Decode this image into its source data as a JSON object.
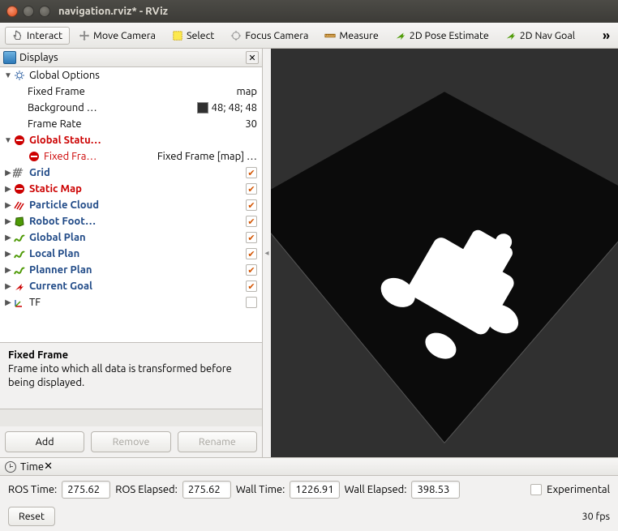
{
  "window": {
    "title": "navigation.rviz* - RViz"
  },
  "toolbar": {
    "interact": "Interact",
    "move_camera": "Move Camera",
    "select": "Select",
    "focus_camera": "Focus Camera",
    "measure": "Measure",
    "pose_estimate": "2D Pose Estimate",
    "nav_goal": "2D Nav Goal"
  },
  "displays": {
    "title": "Displays",
    "global_options": {
      "label": "Global Options"
    },
    "fixed_frame": {
      "label": "Fixed Frame",
      "value": "map"
    },
    "background": {
      "label": "Background …",
      "value": "48; 48; 48"
    },
    "frame_rate": {
      "label": "Frame Rate",
      "value": "30"
    },
    "global_status": {
      "label": "Global Statu…"
    },
    "fixed_frame_status": {
      "label": "Fixed Fra…",
      "value": "Fixed Frame [map] …"
    },
    "grid": {
      "label": "Grid"
    },
    "static_map": {
      "label": "Static Map"
    },
    "particle_cloud": {
      "label": "Particle Cloud"
    },
    "robot_footprint": {
      "label": "Robot Foot…"
    },
    "global_plan": {
      "label": "Global Plan"
    },
    "local_plan": {
      "label": "Local Plan"
    },
    "planner_plan": {
      "label": "Planner Plan"
    },
    "current_goal": {
      "label": "Current Goal"
    },
    "tf": {
      "label": "TF"
    }
  },
  "description": {
    "title": "Fixed Frame",
    "body": "Frame into which all data is transformed before being displayed."
  },
  "buttons": {
    "add": "Add",
    "remove": "Remove",
    "rename": "Rename"
  },
  "time": {
    "title": "Time",
    "ros_time_label": "ROS Time:",
    "ros_time": "275.62",
    "ros_elapsed_label": "ROS Elapsed:",
    "ros_elapsed": "275.62",
    "wall_time_label": "Wall Time:",
    "wall_time": "1226.91",
    "wall_elapsed_label": "Wall Elapsed:",
    "wall_elapsed": "398.53",
    "experimental": "Experimental"
  },
  "footer": {
    "reset": "Reset",
    "fps": "30 fps"
  }
}
